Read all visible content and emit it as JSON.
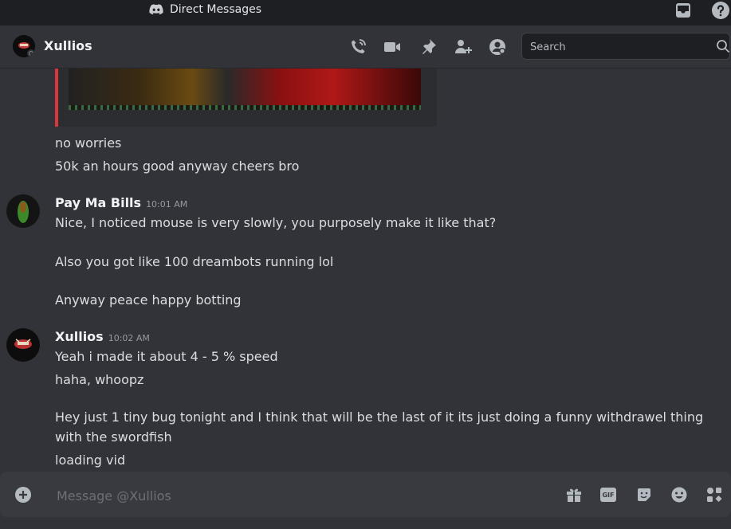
{
  "titlebar": {
    "title": "Direct Messages"
  },
  "header": {
    "name": "Xullios"
  },
  "search": {
    "placeholder": "Search"
  },
  "messages": {
    "line1": "no worries",
    "line2": "50k an hours good anyway cheers bro",
    "author2": "Pay Ma Bills",
    "time2": "10:01 AM",
    "line3": "Nice, I noticed mouse is very slowly, you purposely make it like that?",
    "line4": "Also you got like 100 dreambots running lol",
    "line5": "Anyway peace happy botting",
    "author3": "Xullios",
    "time3": "10:02 AM",
    "line6": "Yeah i made it about 4 - 5 % speed",
    "line7": "haha, whoopz",
    "line8": "Hey just 1 tiny bug tonight and I think that will be the last of it its just doing a funny withdrawel thing with the swordfish",
    "line9": "loading vid"
  },
  "composer": {
    "placeholder": "Message @Xullios",
    "gif_label": "GIF"
  },
  "colors": {
    "background": "#313338",
    "embed_bar": "#da373c",
    "titlebar": "#1e1f22"
  },
  "icons": [
    "discord-icon",
    "inbox-icon",
    "help-icon",
    "call-icon",
    "video-icon",
    "pin-icon",
    "add-friend-icon",
    "profile-icon",
    "search-icon",
    "plus-icon",
    "gift-icon",
    "gif-icon",
    "sticker-icon",
    "emoji-icon",
    "apps-icon"
  ]
}
